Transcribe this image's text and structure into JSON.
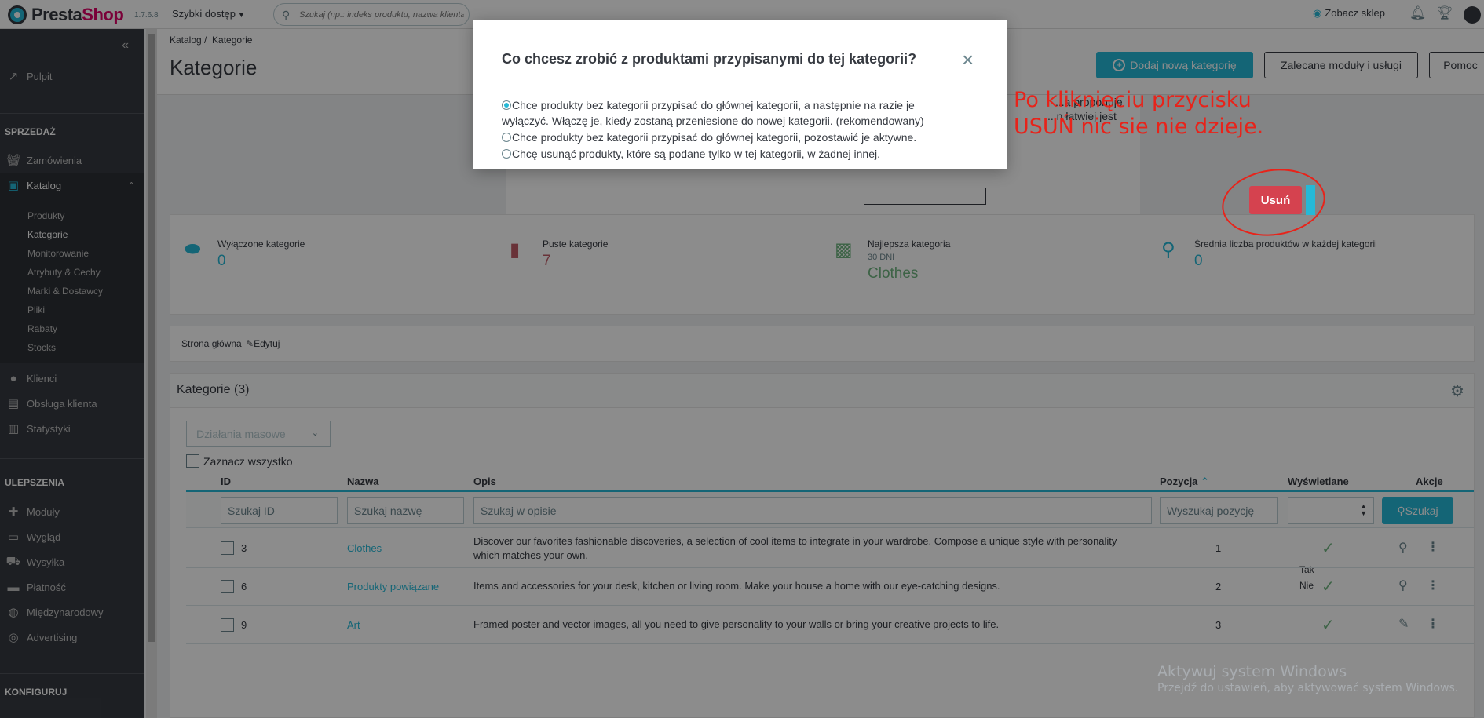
{
  "header": {
    "logo_prefix": "Presta",
    "logo_suffix": "Shop",
    "version": "1.7.6.8",
    "quick_access": "Szybki dostęp",
    "search_placeholder": "Szukaj (np.: indeks produktu, nazwa klienta...)",
    "view_shop": "Zobacz sklep"
  },
  "sidebar": {
    "dashboard": "Pulpit",
    "section_sell": "SPRZEDAŻ",
    "orders": "Zamówienia",
    "catalog": "Katalog",
    "catalog_items": [
      "Produkty",
      "Kategorie",
      "Monitorowanie",
      "Atrybuty & Cechy",
      "Marki & Dostawcy",
      "Pliki",
      "Rabaty",
      "Stocks"
    ],
    "customers": "Klienci",
    "customer_service": "Obsługa klienta",
    "stats": "Statystyki",
    "section_improve": "ULEPSZENIA",
    "modules": "Moduły",
    "design": "Wygląd",
    "shipping": "Wysyłka",
    "payment": "Płatność",
    "international": "Międzynarodowy",
    "advertising": "Advertising",
    "section_configure": "KONFIGURUJ"
  },
  "page": {
    "breadcrumb_parent": "Katalog",
    "breadcrumb_current": "Kategorie",
    "title": "Kategorie",
    "btn_add": "Dodaj nową kategorię",
    "btn_modules": "Zalecane moduły i usługi",
    "btn_help": "Pomoc"
  },
  "promo": {
    "line1": "...ą proponuje",
    "line2": "...n łatwiej jest"
  },
  "kpis": [
    {
      "title": "Wyłączone kategorie",
      "value": "0",
      "color": "#25b9d7"
    },
    {
      "title": "Puste kategorie",
      "value": "7",
      "color": "#c05c67"
    },
    {
      "title": "Najlepsza kategoria",
      "sub": "30 DNI",
      "value": "Clothes",
      "color": "#70b580"
    },
    {
      "title": "Średnia liczba produktów w każdej kategorii",
      "value": "0",
      "color": "#25b9d7"
    }
  ],
  "annotation": {
    "line1": "Po kliknięciu przycisku",
    "line2": "USUŃ nic sie nie dzieje."
  },
  "delete_button": "Usuń",
  "crumb_box": {
    "home": "Strona główna",
    "edit": "Edytuj"
  },
  "categories": {
    "title": "Kategorie (3)",
    "bulk_actions": "Działania masowe",
    "select_all": "Zaznacz wszystko",
    "columns": {
      "id": "ID",
      "name": "Nazwa",
      "desc": "Opis",
      "position": "Pozycja",
      "displayed": "Wyświetlane",
      "actions": "Akcje"
    },
    "filters": {
      "id": "Szukaj ID",
      "name": "Szukaj nazwę",
      "desc": "Szukaj w opisie",
      "position": "Wyszukaj pozycję",
      "search_btn": "Szukaj"
    },
    "displayed_options": [
      "Tak",
      "Nie"
    ],
    "rows": [
      {
        "id": "3",
        "name": "Clothes",
        "desc1": "Discover our favorites fashionable discoveries, a selection of cool items to integrate in your wardrobe. Compose a unique style with personality",
        "desc2": "which matches your own.",
        "position": "1"
      },
      {
        "id": "6",
        "name": "Produkty powiązane",
        "desc1": "Items and accessories for your desk, kitchen or living room. Make your house a home with our eye-catching designs.",
        "desc2": "",
        "position": "2"
      },
      {
        "id": "9",
        "name": "Art",
        "desc1": "Framed poster and vector images, all you need to give personality to your walls or bring your creative projects to life.",
        "desc2": "",
        "position": "3"
      }
    ]
  },
  "watermark": {
    "line1": "Aktywuj system Windows",
    "line2": "Przejdź do ustawień, aby aktywować system Windows."
  },
  "modal": {
    "title": "Co chcesz zrobić z produktami przypisanymi do tej kategorii?",
    "option1_a": "Chce produkty bez kategorii przypisać do głównej kategorii, a następnie na razie je",
    "option1_b": "wyłączyć. Włączę je, kiedy zostaną przeniesione do nowej kategorii. (rekomendowany)",
    "option2": "Chce produkty bez kategorii przypisać do głównej kategorii, pozostawić je aktywne.",
    "option3": "Chcę usunąć produkty, które są podane tylko w tej kategorii, w żadnej innej."
  }
}
